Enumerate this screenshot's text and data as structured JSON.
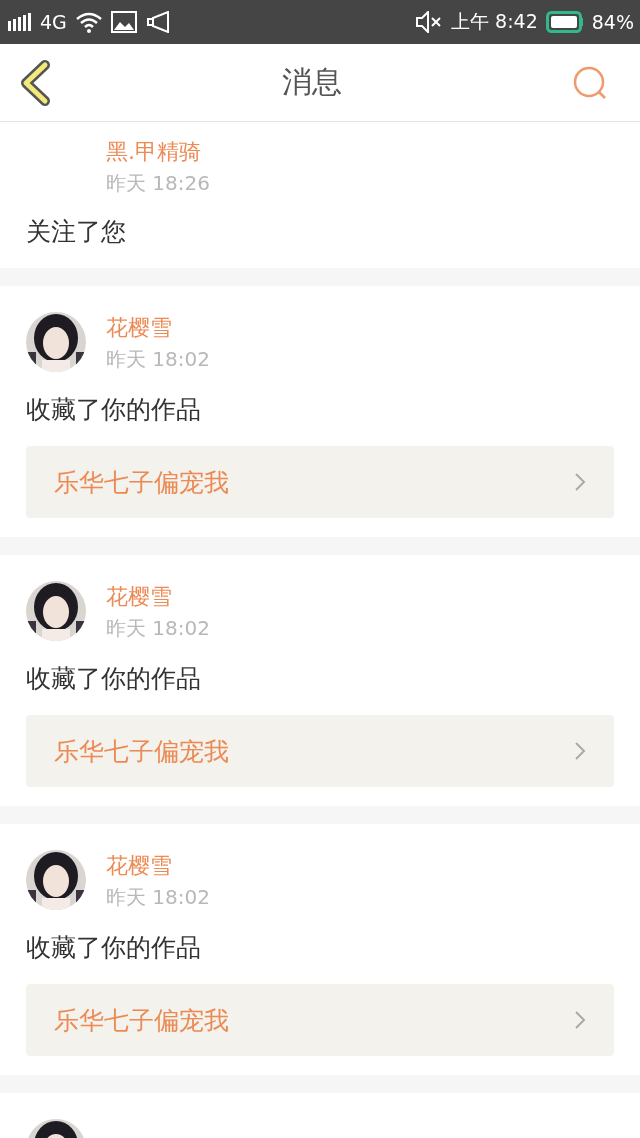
{
  "status_bar": {
    "network": "4G",
    "time": "上午 8:42",
    "battery": "84%"
  },
  "header": {
    "title": "消息"
  },
  "messages": [
    {
      "avatar": false,
      "name": "黑.甲精骑",
      "time": "昨天 18:26",
      "action": "关注了您"
    },
    {
      "avatar": true,
      "name": "花樱雪",
      "time": "昨天 18:02",
      "action": "收藏了你的作品",
      "work": "乐华七子偏宠我"
    },
    {
      "avatar": true,
      "name": "花樱雪",
      "time": "昨天 18:02",
      "action": "收藏了你的作品",
      "work": "乐华七子偏宠我"
    },
    {
      "avatar": true,
      "name": "花樱雪",
      "time": "昨天 18:02",
      "action": "收藏了你的作品",
      "work": "乐华七子偏宠我"
    },
    {
      "avatar": true
    }
  ]
}
